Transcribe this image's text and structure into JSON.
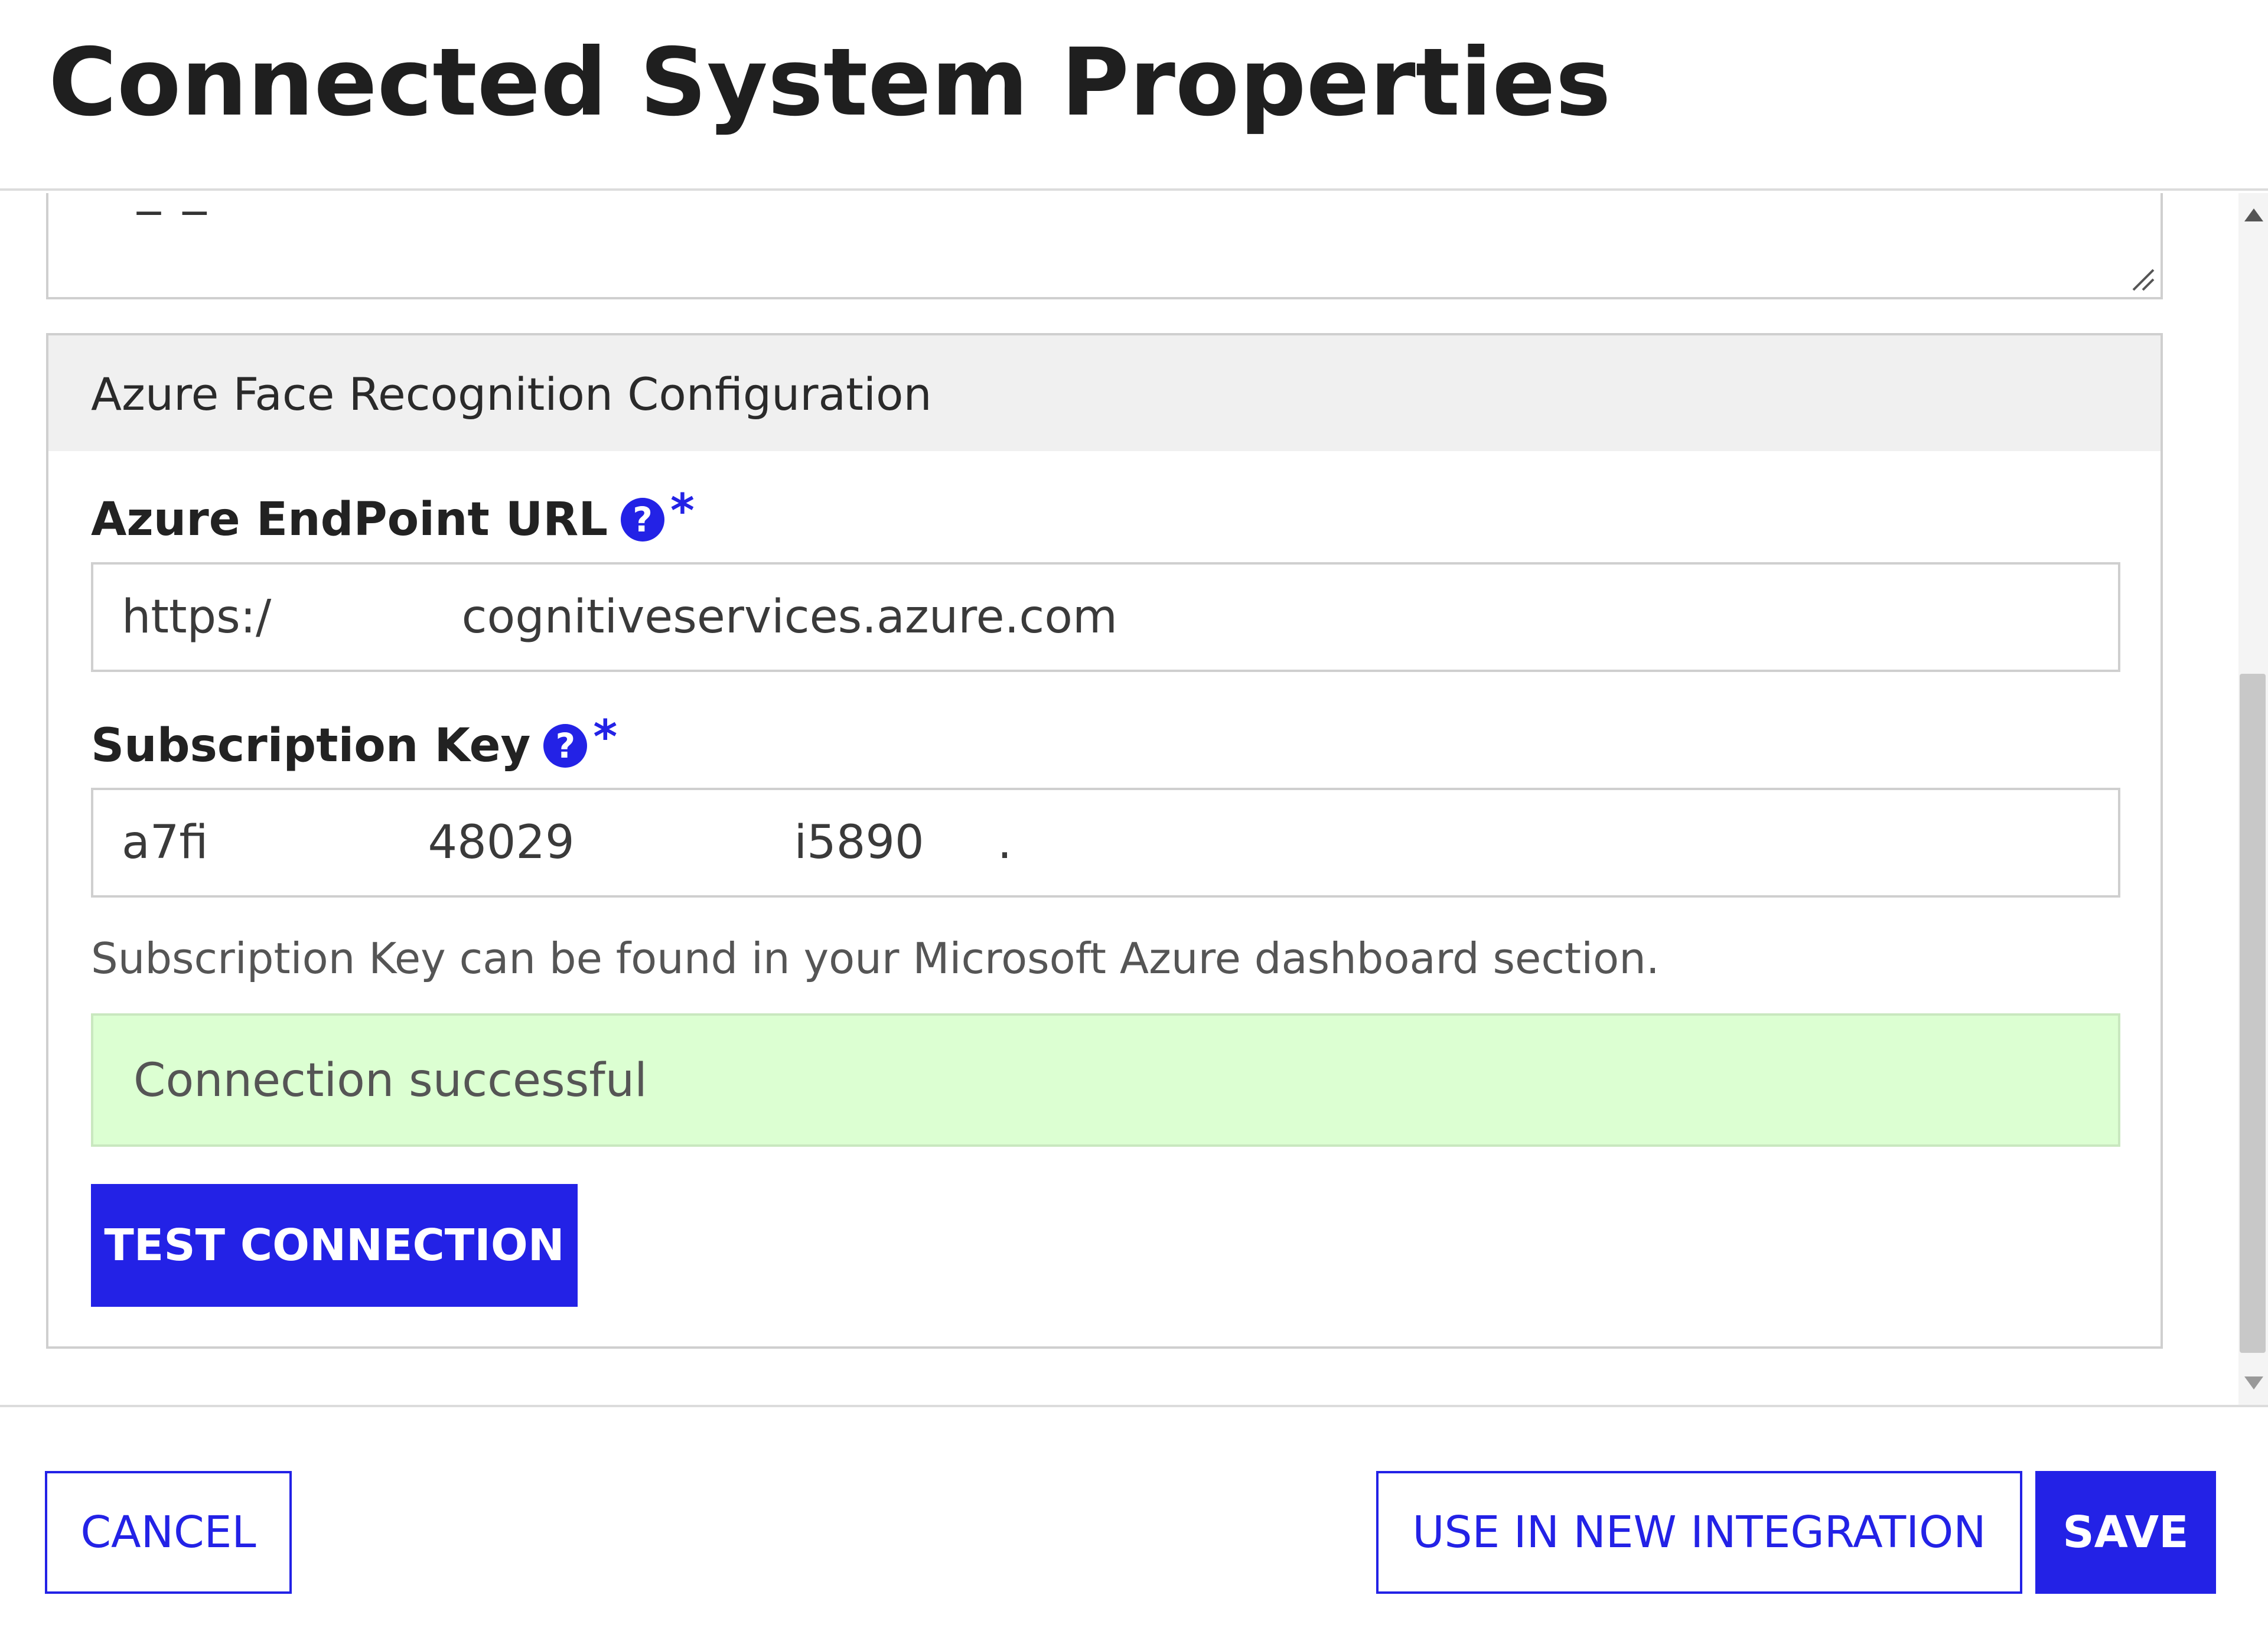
{
  "dialog": {
    "title": "Connected System Properties"
  },
  "description": {
    "partial_text": "_        _"
  },
  "config": {
    "section_title": "Azure Face Recognition Configuration",
    "endpoint": {
      "label": "Azure EndPoint URL",
      "value": "https:/             cognitiveservices.azure.com",
      "required": "*",
      "help_icon": "question-mark-icon"
    },
    "subscription": {
      "label": "Subscription Key",
      "value": "a7fi               48029               i5890     .",
      "required": "*",
      "help_icon": "question-mark-icon",
      "helper": "Subscription Key can be found in your Microsoft Azure dashboard section."
    },
    "status": {
      "message": "Connection successful",
      "color": "#dcffd2"
    },
    "test_button": "TEST CONNECTION"
  },
  "footer": {
    "cancel": "CANCEL",
    "use_in_new_integration": "USE IN NEW INTEGRATION",
    "save": "SAVE"
  },
  "colors": {
    "accent": "#2322e6",
    "success_bg": "#dcffd2"
  }
}
